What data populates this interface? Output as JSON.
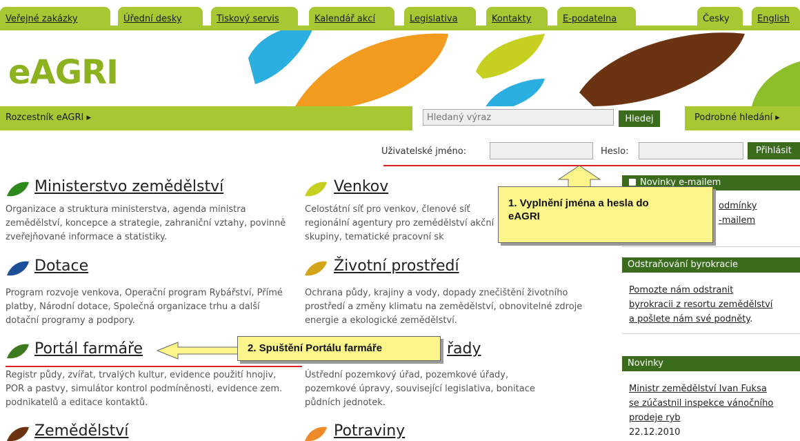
{
  "top_tabs": [
    {
      "label": "Veřejné zakázky"
    },
    {
      "label": "Úřední desky"
    },
    {
      "label": "Tiskový servis"
    },
    {
      "label": "Kalendář akcí"
    },
    {
      "label": "Legislativa"
    },
    {
      "label": "Kontakty"
    },
    {
      "label": "E-podatelna"
    },
    {
      "label": "Česky"
    },
    {
      "label": "English"
    }
  ],
  "logo": "eAGRI",
  "nav": {
    "rozcestnik": "Rozcestník eAGRI",
    "search_placeholder": "Hledaný výraz",
    "search_button": "Hledej",
    "detail_search": "Podrobné hledání"
  },
  "login": {
    "username_label": "Uživatelské jméno:",
    "password_label": "Heslo:",
    "button": "Přihlásit"
  },
  "sections": {
    "ministerstvo": {
      "title": "Ministerstvo zemědělství",
      "desc": "Organizace a struktura ministerstva, agenda ministra zemědělství, koncepce a strategie, zahraniční vztahy, povinně zveřejňované informace a statistiky."
    },
    "venkov": {
      "title": "Venkov",
      "desc": "Celostátní síť pro venkov, členové síť regionální agentury pro zemědělství akční skupiny, tematické pracovní sk"
    },
    "dotace": {
      "title": "Dotace",
      "desc": "Program rozvoje venkova, Operační program Rybářství, Přímé platby, Národní dotace, Společná organizace trhu a další dotační programy a podpory."
    },
    "zivotni": {
      "title": "Životní prostředí",
      "desc": "Ochrana půdy, krajiny a vody, dopady znečištění životního prostředí a změny klimatu na zemědělství, obnovitelné zdroje energie a ekologické zemědělství."
    },
    "portal": {
      "title": "Portál farmáře",
      "desc": "Registr půdy, zvířat, trvalých kultur, evidence použití hnojiv, POR a pastvy, simulátor kontrol podmíněnosti, evidence zem. podnikatelů a editace kontaktů."
    },
    "urady": {
      "title": "řady",
      "desc": "Ústřední pozemkový úřad, pozemkové úřady, pozemkové úpravy, související legislativa, bonitace půdních jednotek."
    },
    "zemedelstvi": {
      "title": "Zemědělství"
    },
    "potraviny": {
      "title": "Potraviny"
    }
  },
  "sidebar": {
    "news_email_head": "Novinky e-mailem",
    "news_email_link1": "odmínky",
    "news_email_link2": "-mailem",
    "byro_head": "Odstraňování byrokracie",
    "byro_link1": "Pomozte nám odstranit",
    "byro_link2": "byrokracii z resortu zemědělství",
    "byro_link3": "a pošlete nám své podněty",
    "byro_tail": ".",
    "novinky_head": "Novinky",
    "novinky_link1": "Ministr zemědělství Ivan Fuksa",
    "novinky_link2": "se zúčastnil inspekce vánočního",
    "novinky_link3": "prodeje ryb",
    "novinky_date": "22.12.2010"
  },
  "callouts": {
    "one_line1": "1. Vyplnění jména a hesla do",
    "one_line2": "eAGRI",
    "two": "2. Spuštění Portálu farmáře"
  },
  "colors": {
    "brand_green": "#a7c832",
    "dark_green": "#3b6c1e",
    "callout_yellow": "#fbf58a",
    "annotation_red": "#e02020"
  }
}
